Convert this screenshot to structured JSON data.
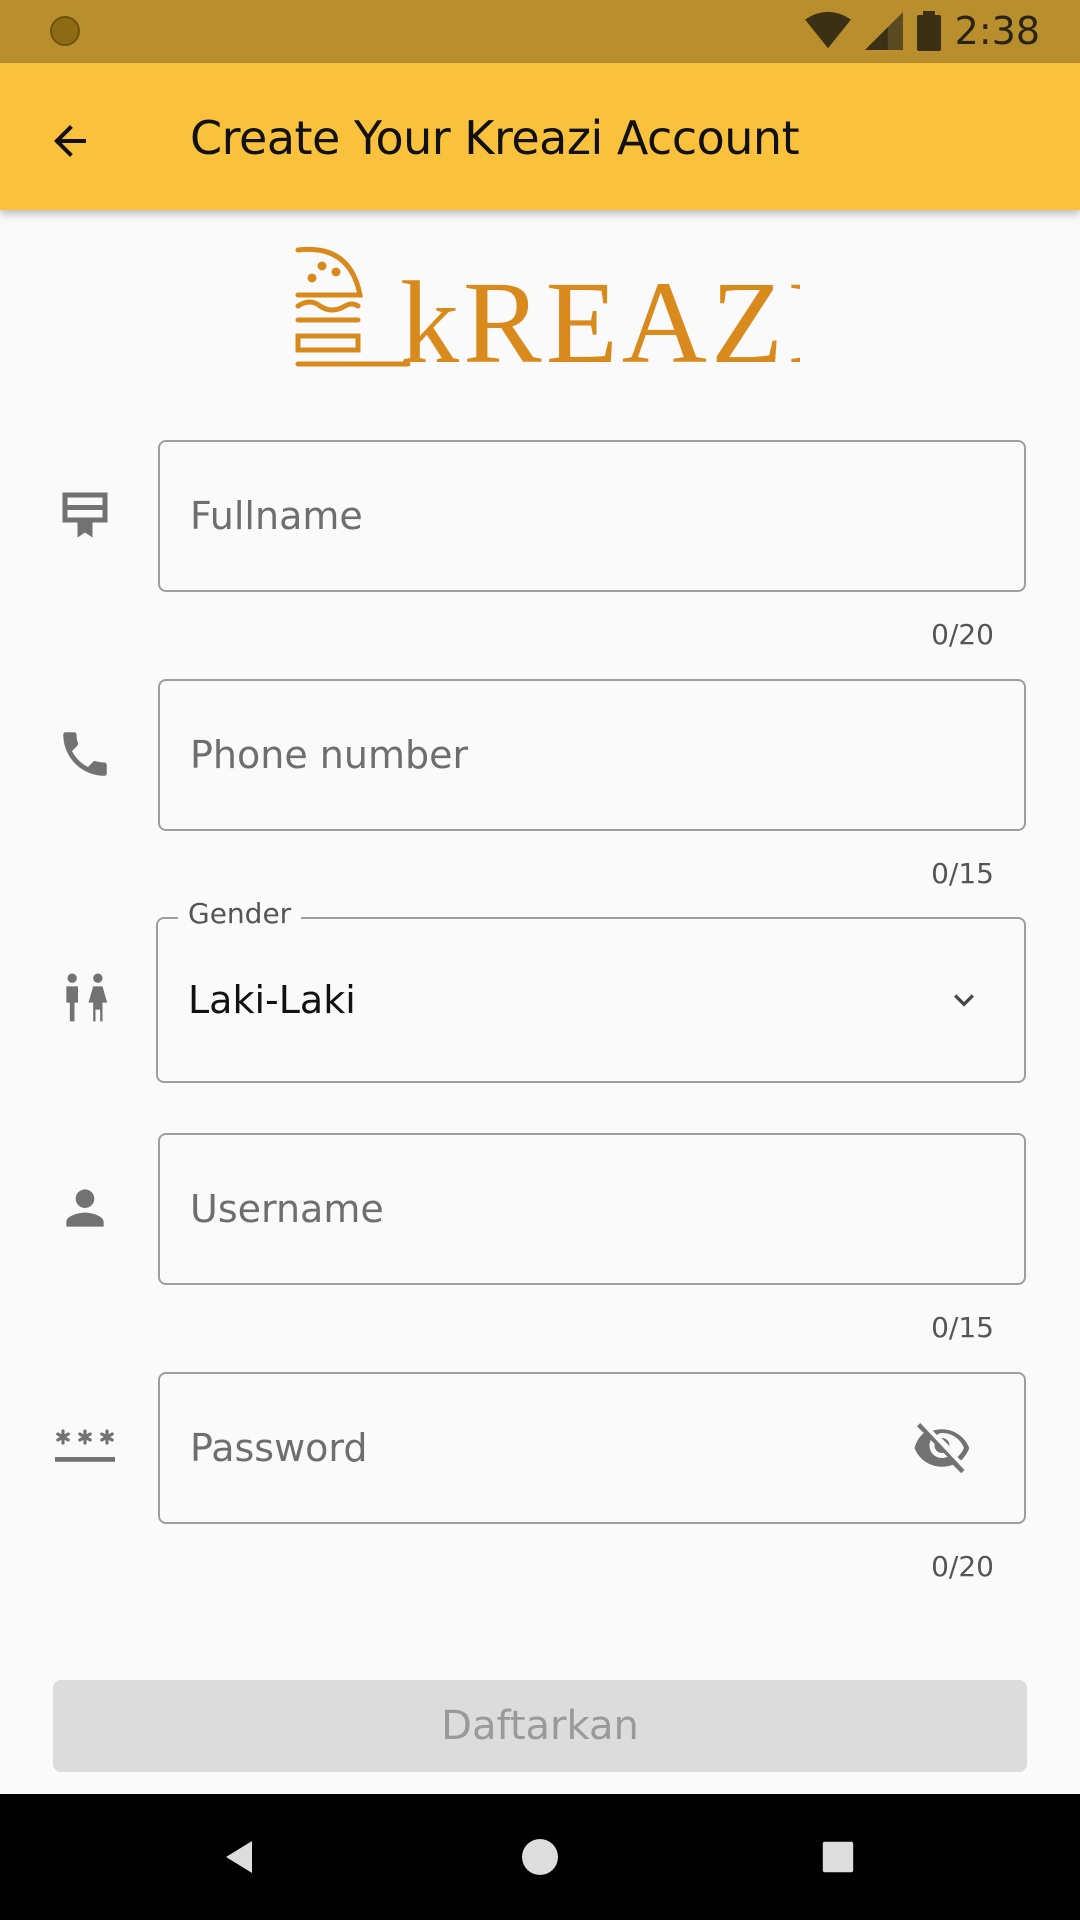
{
  "status_bar": {
    "time": "2:38"
  },
  "app_bar": {
    "title": "Create Your Kreazi Account",
    "back_icon": "arrow-back-icon",
    "color": "#fac13c"
  },
  "logo": {
    "text": "KREAZI",
    "color": "#d88a1d"
  },
  "form": {
    "fullname": {
      "placeholder": "Fullname",
      "value": "",
      "counter": "0/20",
      "icon": "card-icon"
    },
    "phone": {
      "placeholder": "Phone number",
      "value": "",
      "counter": "0/15",
      "icon": "phone-icon"
    },
    "gender": {
      "label": "Gender",
      "selected": "Laki-Laki",
      "icon": "wc-icon"
    },
    "username": {
      "placeholder": "Username",
      "value": "",
      "counter": "0/15",
      "icon": "person-icon"
    },
    "password": {
      "placeholder": "Password",
      "value": "",
      "counter": "0/20",
      "icon": "password-icon",
      "visibility_icon": "visibility-off-icon"
    }
  },
  "submit": {
    "label": "Daftarkan",
    "enabled": false
  },
  "nav": {
    "back": "nav-back-icon",
    "home": "nav-home-icon",
    "recents": "nav-recents-icon"
  }
}
